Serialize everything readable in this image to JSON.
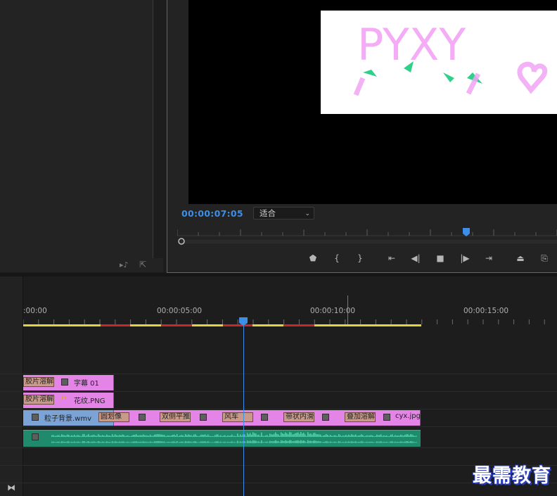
{
  "monitor": {
    "timecode": "00:00:07:05",
    "fit_label": "适合",
    "fit_chevron": "⌄",
    "image_text": "PYXY",
    "controls": [
      "marker-icon",
      "mark-in-icon",
      "mark-out-icon",
      "go-to-in-icon",
      "step-back-icon",
      "stop-icon",
      "step-forward-icon",
      "go-to-out-icon",
      "lift-icon",
      "extract-icon"
    ]
  },
  "project_footer": {
    "icons": [
      "audio-note-icon",
      "export-icon"
    ]
  },
  "timeline": {
    "ruler_labels": [
      ":00:00",
      "00:00:05:00",
      "00:00:10:00",
      "00:00:15:00"
    ],
    "tracks": {
      "v3": {
        "clip_label": "字幕 01",
        "transition": "胶片溶解"
      },
      "v2": {
        "clip_label": "花纹.PNG",
        "transition": "胶片溶解",
        "fx": "fx"
      },
      "v1": {
        "first_clip": "粒子背景.wmv",
        "transitions": [
          "圆划像",
          "双侧平推门",
          "风车",
          "带状内滑",
          "叠加溶解"
        ],
        "last_clip": "cyx.jpg"
      }
    }
  },
  "watermark": "最需教育",
  "colors": {
    "accent": "#3d8ee6",
    "clip_pink": "#e384e6",
    "clip_blue": "#7ba3d6",
    "audio_green": "#1f8b6c",
    "render_yellow": "#e3d33c",
    "render_red": "#c8282a"
  }
}
